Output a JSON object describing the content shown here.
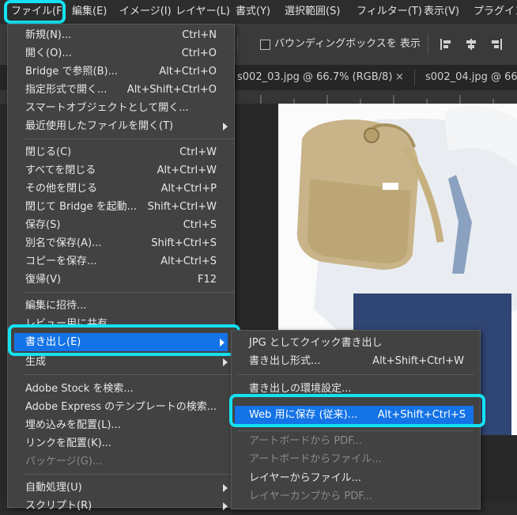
{
  "menubar": {
    "items": [
      "ファイル(F)",
      "編集(E)",
      "イメージ(I)",
      "レイヤー(L)",
      "書式(Y)",
      "選択範囲(S)",
      "フィルター(T)",
      "表示(V)",
      "プラグイン"
    ]
  },
  "options_bar": {
    "bounding_box_label": "バウンディングボックスを 表示"
  },
  "tabs": [
    "s002_03.jpg @ 66.7% (RGB/8)",
    "s002_04.jpg @ 66"
  ],
  "tab_close_glyph": "×",
  "file_menu": {
    "items": [
      {
        "label": "新規(N)...",
        "shortcut": "Ctrl+N"
      },
      {
        "label": "開く(O)...",
        "shortcut": "Ctrl+O"
      },
      {
        "label": "Bridge で参照(B)...",
        "shortcut": "Alt+Ctrl+O"
      },
      {
        "label": "指定形式で開く...",
        "shortcut": "Alt+Shift+Ctrl+O"
      },
      {
        "label": "スマートオブジェクトとして開く...",
        "shortcut": ""
      },
      {
        "label": "最近使用したファイルを開く(T)",
        "shortcut": ""
      },
      {
        "label": "閉じる(C)",
        "shortcut": "Ctrl+W"
      },
      {
        "label": "すべてを閉じる",
        "shortcut": "Alt+Ctrl+W"
      },
      {
        "label": "その他を閉じる",
        "shortcut": "Alt+Ctrl+P"
      },
      {
        "label": "閉じて Bridge を起動...",
        "shortcut": "Shift+Ctrl+W"
      },
      {
        "label": "保存(S)",
        "shortcut": "Ctrl+S"
      },
      {
        "label": "別名で保存(A)...",
        "shortcut": "Shift+Ctrl+S"
      },
      {
        "label": "コピーを保存...",
        "shortcut": "Alt+Ctrl+S"
      },
      {
        "label": "復帰(V)",
        "shortcut": "F12"
      },
      {
        "label": "編集に招待...",
        "shortcut": ""
      },
      {
        "label": "レビュー用に共有...",
        "shortcut": ""
      },
      {
        "label": "書き出し(E)",
        "shortcut": ""
      },
      {
        "label": "生成",
        "shortcut": ""
      },
      {
        "label": "Adobe Stock を検索...",
        "shortcut": ""
      },
      {
        "label": "Adobe Express のテンプレートの検索...",
        "shortcut": ""
      },
      {
        "label": "埋め込みを配置(L)...",
        "shortcut": ""
      },
      {
        "label": "リンクを配置(K)...",
        "shortcut": ""
      },
      {
        "label": "パッケージ(G)...",
        "shortcut": ""
      },
      {
        "label": "自動処理(U)",
        "shortcut": ""
      },
      {
        "label": "スクリプト(R)",
        "shortcut": ""
      }
    ]
  },
  "export_submenu": {
    "items": [
      {
        "label": "JPG としてクイック書き出し",
        "shortcut": ""
      },
      {
        "label": "書き出し形式...",
        "shortcut": "Alt+Shift+Ctrl+W"
      },
      {
        "label": "書き出しの環境設定...",
        "shortcut": ""
      },
      {
        "label": "Web 用に保存 (従来)...",
        "shortcut": "Alt+Shift+Ctrl+S"
      },
      {
        "label": "アートボードから PDF...",
        "shortcut": ""
      },
      {
        "label": "アートボードからファイル...",
        "shortcut": ""
      },
      {
        "label": "レイヤーからファイル...",
        "shortcut": ""
      },
      {
        "label": "レイヤーカンプから PDF...",
        "shortcut": ""
      }
    ]
  },
  "colors": {
    "highlight_ring": "#14e2f2",
    "menu_selection": "#1473e6",
    "menu_background": "#424242"
  }
}
